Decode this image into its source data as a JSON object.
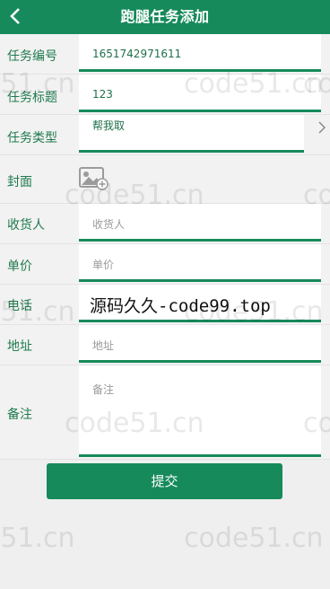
{
  "header": {
    "title": "跑腿任务添加",
    "back_icon": "chevron-left-icon"
  },
  "form": {
    "task_no": {
      "label": "任务编号",
      "value": "1651742971611"
    },
    "task_title": {
      "label": "任务标题",
      "value": "123"
    },
    "task_type": {
      "label": "任务类型",
      "value": "帮我取"
    },
    "cover": {
      "label": "封面",
      "icon": "image-upload-icon"
    },
    "receiver": {
      "label": "收货人",
      "placeholder": "收货人"
    },
    "price": {
      "label": "单价",
      "placeholder": "单价"
    },
    "phone": {
      "label": "电话",
      "placeholder": ""
    },
    "address": {
      "label": "地址",
      "placeholder": "地址"
    },
    "note": {
      "label": "备注",
      "placeholder": "备注"
    }
  },
  "submit_label": "提交",
  "overlay_text": "源码久久-code99.top",
  "watermark_text": "code51.cn",
  "colors": {
    "primary": "#168a5b"
  }
}
